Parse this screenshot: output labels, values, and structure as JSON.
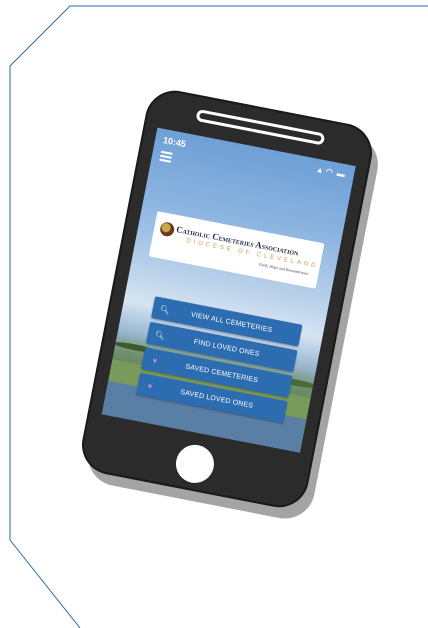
{
  "status_bar": {
    "time": "10:45",
    "icons": "signal-wifi-battery"
  },
  "logo": {
    "title": "Catholic Cemeteries Association",
    "subtitle": "DIOCESE OF CLEVELAND",
    "tagline": "Faith, Hope and Remembrance"
  },
  "menu": [
    {
      "label": "VIEW ALL CEMETERIES",
      "icon": "search-icon"
    },
    {
      "label": "FIND LOVED ONES",
      "icon": "search-icon"
    },
    {
      "label": "SAVED CEMETERIES",
      "icon": "heart-icon"
    },
    {
      "label": "SAVED LOVED ONES",
      "icon": "heart-icon"
    }
  ],
  "colors": {
    "button": "#2c6cb0",
    "heart": "#b48ad8",
    "frame_line": "#2a6aa8",
    "phone": "#2b2b2b"
  }
}
